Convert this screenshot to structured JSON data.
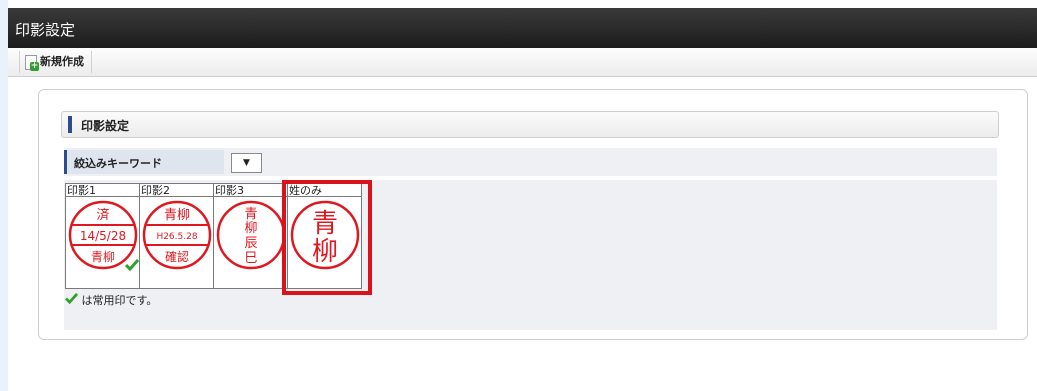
{
  "window": {
    "title": "印影設定"
  },
  "toolbar": {
    "new_label": "新規作成"
  },
  "section": {
    "title": "印影設定"
  },
  "filter": {
    "label": "絞込みキーワード",
    "select_value": "▼"
  },
  "stamps": [
    {
      "caption": "印影1",
      "lines": [
        "済",
        "14/5/28",
        "青柳"
      ],
      "common": true
    },
    {
      "caption": "印影2",
      "lines": [
        "青柳",
        "H26.5.28",
        "確認"
      ],
      "common": false
    },
    {
      "caption": "印影3",
      "lines": [
        "青",
        "柳",
        "辰",
        "巳"
      ],
      "common": false
    },
    {
      "caption": "姓のみ",
      "lines": [
        "青",
        "柳"
      ],
      "common": false,
      "selected": true
    }
  ],
  "note": {
    "text": "は常用印です。"
  },
  "colors": {
    "seal_red": "#e0171f",
    "highlight_red": "#d9121b",
    "check_green": "#2fa030"
  }
}
